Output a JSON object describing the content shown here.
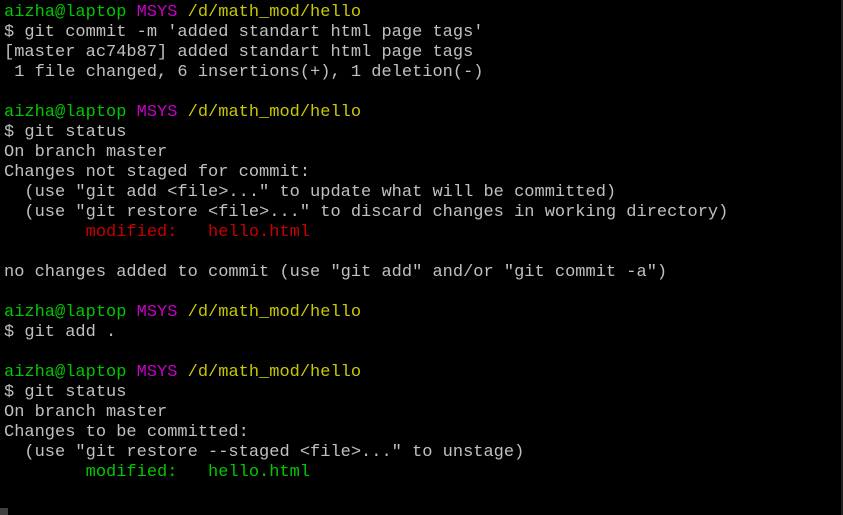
{
  "prompt": {
    "user": "aizha@laptop",
    "env": "MSYS",
    "path": "/d/math_mod/hello",
    "symbol": "$"
  },
  "lines": {
    "l2": "$ git commit -m 'added standart html page tags'",
    "l3": "[master ac74b87] added standart html page tags",
    "l4": " 1 file changed, 6 insertions(+), 1 deletion(-)",
    "l7": "$ git status",
    "l8": "On branch master",
    "l9": "Changes not staged for commit:",
    "l10": "  (use \"git add <file>...\" to update what will be committed)",
    "l11": "  (use \"git restore <file>...\" to discard changes in working directory)",
    "l12_label": "        modified:   ",
    "l12_file": "hello.html",
    "l14": "no changes added to commit (use \"git add\" and/or \"git commit -a\")",
    "l17": "$ git add .",
    "l20": "$ git status",
    "l21": "On branch master",
    "l22": "Changes to be committed:",
    "l23": "  (use \"git restore --staged <file>...\" to unstage)",
    "l24_label": "        modified:   ",
    "l24_file": "hello.html"
  },
  "colors": {
    "background": "#000000",
    "text": "#c0c0c0",
    "user": "#00c800",
    "env": "#c800c8",
    "path": "#c8c800",
    "modified_unstaged": "#c80000",
    "modified_staged": "#00c800"
  }
}
